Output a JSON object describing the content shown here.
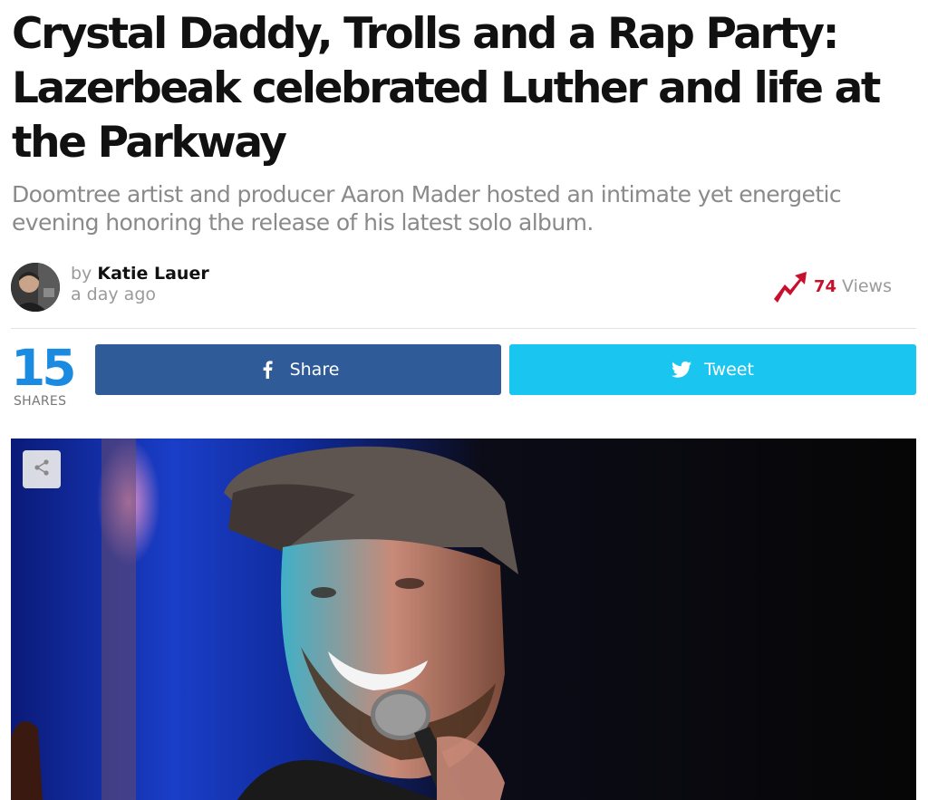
{
  "article": {
    "title": "Crystal Daddy, Trolls and a Rap Party: Lazerbeak celebrated Luther and life at the Parkway",
    "subtitle": "Doomtree artist and producer Aaron Mader hosted an intimate yet energetic evening honoring the release of his latest solo album."
  },
  "byline": {
    "prefix": "by",
    "author": "Katie Lauer",
    "date": "a day ago"
  },
  "views": {
    "count": "74",
    "label": "Views",
    "icon": "trending-up-icon",
    "color": "#c8102e"
  },
  "shares": {
    "count": "15",
    "label": "SHARES",
    "color": "#1a8be0"
  },
  "buttons": {
    "facebook": {
      "label": "Share",
      "icon": "facebook-icon",
      "color": "#305b99"
    },
    "twitter": {
      "label": "Tweet",
      "icon": "twitter-icon",
      "color": "#1ac5ef"
    }
  },
  "hero": {
    "share_icon": "share-icon"
  }
}
